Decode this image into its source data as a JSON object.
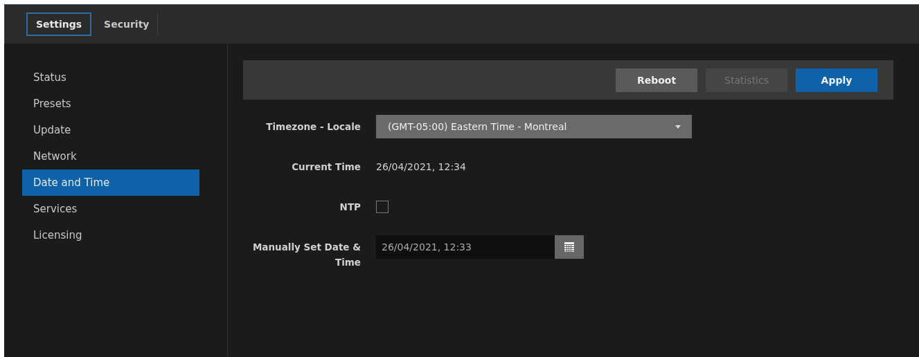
{
  "tabs": [
    {
      "label": "Settings",
      "selected": true
    },
    {
      "label": "Security",
      "selected": false
    }
  ],
  "sidebar": {
    "items": [
      {
        "label": "Status",
        "selected": false
      },
      {
        "label": "Presets",
        "selected": false
      },
      {
        "label": "Update",
        "selected": false
      },
      {
        "label": "Network",
        "selected": false
      },
      {
        "label": "Date and Time",
        "selected": true
      },
      {
        "label": "Services",
        "selected": false
      },
      {
        "label": "Licensing",
        "selected": false
      }
    ]
  },
  "toolbar": {
    "buttons": [
      {
        "label": "Reboot",
        "kind": "secondary",
        "disabled": false
      },
      {
        "label": "Statistics",
        "kind": "secondary",
        "disabled": true
      },
      {
        "label": "Apply",
        "kind": "primary",
        "disabled": false
      }
    ]
  },
  "form": [
    {
      "kind": "select",
      "label": "Timezone - Locale",
      "value": "(GMT-05:00) Eastern Time - Montreal"
    },
    {
      "kind": "text",
      "label": "Current Time",
      "value": "26/04/2021, 12:34"
    },
    {
      "kind": "checkbox",
      "label": "NTP",
      "checked": false
    },
    {
      "kind": "date",
      "label": "Manually Set Date & Time",
      "value": "26/04/2021, 12:33"
    }
  ]
}
